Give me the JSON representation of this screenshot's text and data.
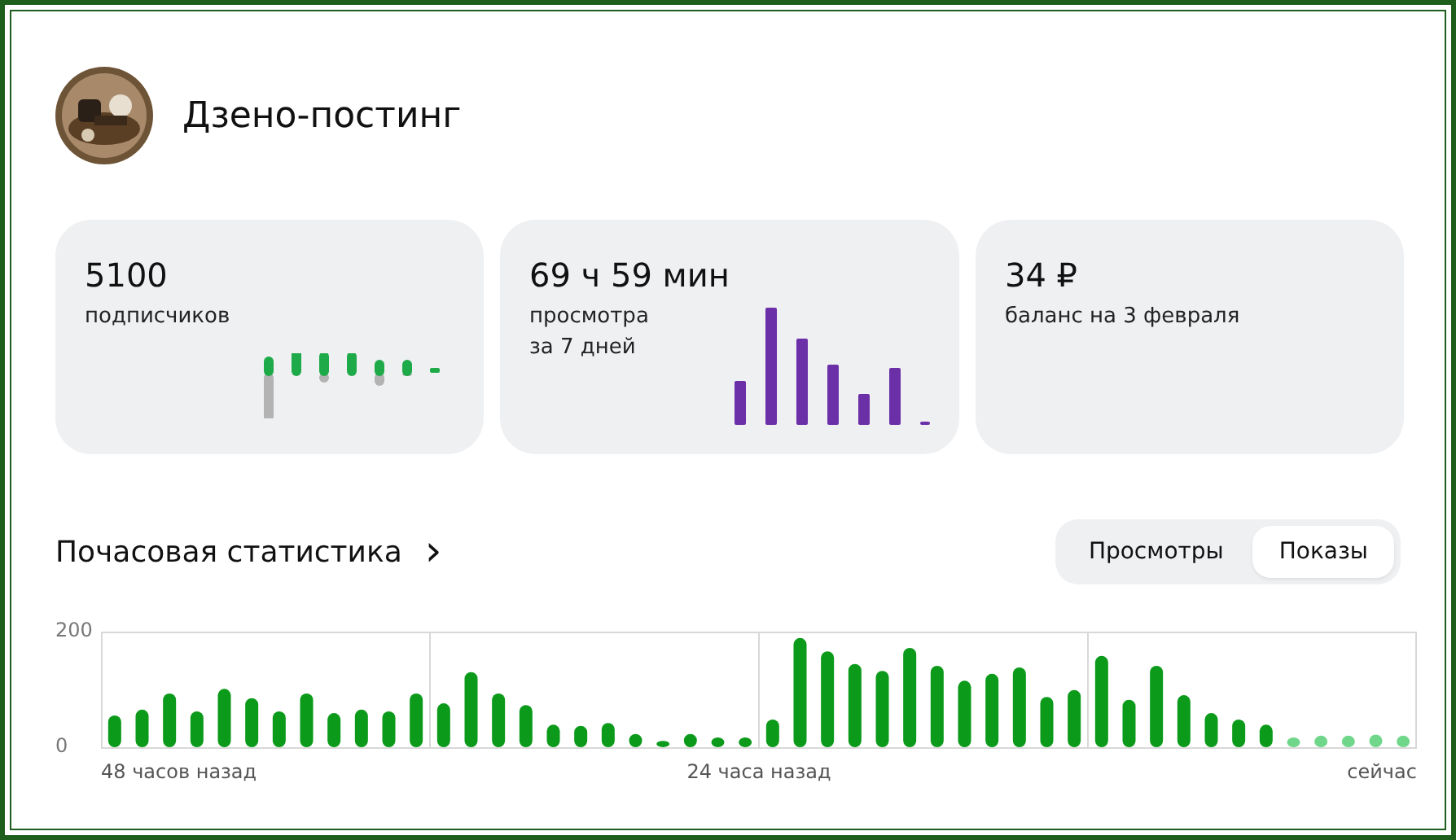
{
  "channel": {
    "title": "Дзено-постинг"
  },
  "cards": [
    {
      "value": "5100",
      "label": "подписчиков",
      "kind": "diverging"
    },
    {
      "value": "69 ч 59 мин",
      "label": "просмотра\nза 7 дней",
      "kind": "bars"
    },
    {
      "value": "34 ₽",
      "label": "баланс на 3 февраля",
      "kind": "plain"
    }
  ],
  "hourly": {
    "title": "Почасовая статистика",
    "arrow": "›",
    "x_labels": [
      "48 часов назад",
      "24 часа назад",
      "сейчас"
    ],
    "toggle": [
      {
        "label": "Просмотры",
        "selected": false
      },
      {
        "label": "Показы",
        "selected": true
      }
    ],
    "chart_data": {
      "type": "bar",
      "stacked": true,
      "grid": true,
      "ylim": [
        0,
        200
      ],
      "yticks": [
        0,
        200
      ],
      "categories": [
        null,
        null,
        null,
        null,
        null,
        null,
        null,
        null,
        null,
        null,
        null,
        null,
        null,
        null,
        null,
        null,
        null,
        null,
        null,
        null,
        null,
        null,
        null,
        null,
        null,
        null,
        null,
        null,
        null,
        null,
        null,
        null,
        null,
        null,
        null,
        null,
        null,
        null,
        null,
        null,
        null,
        null,
        null,
        null,
        null,
        null,
        null,
        null
      ],
      "series": [
        {
          "color": "#0b9a1a",
          "values": [
            55,
            65,
            93,
            62,
            101,
            85,
            62,
            93,
            59,
            65,
            62,
            93,
            76,
            130,
            93,
            73,
            39,
            37,
            42,
            23,
            11,
            23,
            17,
            17,
            48,
            189,
            166,
            144,
            132,
            172,
            141,
            115,
            127,
            138,
            87,
            99,
            158,
            82,
            141,
            90,
            59,
            48,
            39,
            null,
            null,
            null,
            null,
            null
          ]
        },
        {
          "color": "#6fd68a",
          "values": [
            null,
            null,
            null,
            null,
            null,
            null,
            null,
            null,
            null,
            null,
            null,
            null,
            null,
            null,
            null,
            null,
            null,
            null,
            null,
            null,
            null,
            null,
            null,
            null,
            null,
            null,
            null,
            null,
            null,
            null,
            null,
            null,
            null,
            null,
            null,
            null,
            null,
            null,
            null,
            null,
            null,
            null,
            null,
            17,
            20,
            20,
            22,
            20
          ]
        }
      ]
    }
  }
}
